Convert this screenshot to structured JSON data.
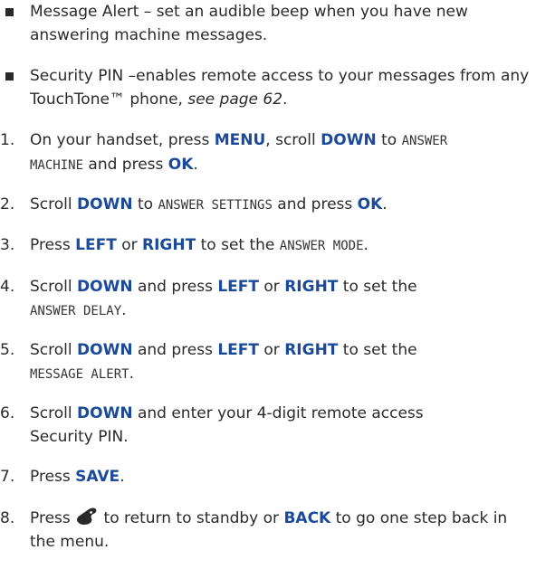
{
  "bullets": [
    {
      "label": "Message Alert",
      "text": " – set an audible beep when you have new answering machine messages."
    },
    {
      "label": "Security PIN",
      "text": " –enables remote access to your messages from any TouchTone™ phone, ",
      "ref": "see page 62",
      "end": "."
    }
  ],
  "steps": {
    "s1": {
      "num": "1.",
      "a": "On your handset, press ",
      "k1": "MENU",
      "b": ", scroll ",
      "k2": "DOWN",
      "c": " to ",
      "lcd1": "ANSWER",
      "lcd2": "MACHINE",
      "d": " and press ",
      "k3": "OK",
      "e": "."
    },
    "s2": {
      "num": "2.",
      "a": "Scroll ",
      "k1": "DOWN",
      "b": " to ",
      "lcd": "ANSWER SETTINGS",
      "c": " and press ",
      "k2": "OK",
      "d": "."
    },
    "s3": {
      "num": "3.",
      "a": "Press ",
      "k1": "LEFT",
      "b": " or ",
      "k2": "RIGHT",
      "c": " to set the ",
      "lcd": "ANSWER MODE",
      "d": "."
    },
    "s4": {
      "num": "4.",
      "a": "Scroll ",
      "k1": "DOWN",
      "b": " and press ",
      "k2": "LEFT",
      "c": " or ",
      "k3": "RIGHT",
      "d": " to set the",
      "lcd": "ANSWER DELAY",
      "e": "."
    },
    "s5": {
      "num": "5.",
      "a": "Scroll ",
      "k1": "DOWN",
      "b": " and press ",
      "k2": "LEFT",
      "c": " or ",
      "k3": "RIGHT",
      "d": " to set the",
      "lcd": "MESSAGE ALERT",
      "e": "."
    },
    "s6": {
      "num": "6.",
      "a": "Scroll ",
      "k1": "DOWN",
      "b": " and enter your 4-digit remote access Security PIN."
    },
    "s7": {
      "num": "7.",
      "a": "Press ",
      "k1": "SAVE",
      "b": "."
    },
    "s8": {
      "num": "8.",
      "a": "Press ",
      "icon": "end-call-icon",
      "b": " to return to standby or ",
      "k1": "BACK",
      "c": " to go one step back in the menu."
    }
  },
  "colors": {
    "keyword": "#1b4a9a",
    "text": "#2a2a2a"
  }
}
